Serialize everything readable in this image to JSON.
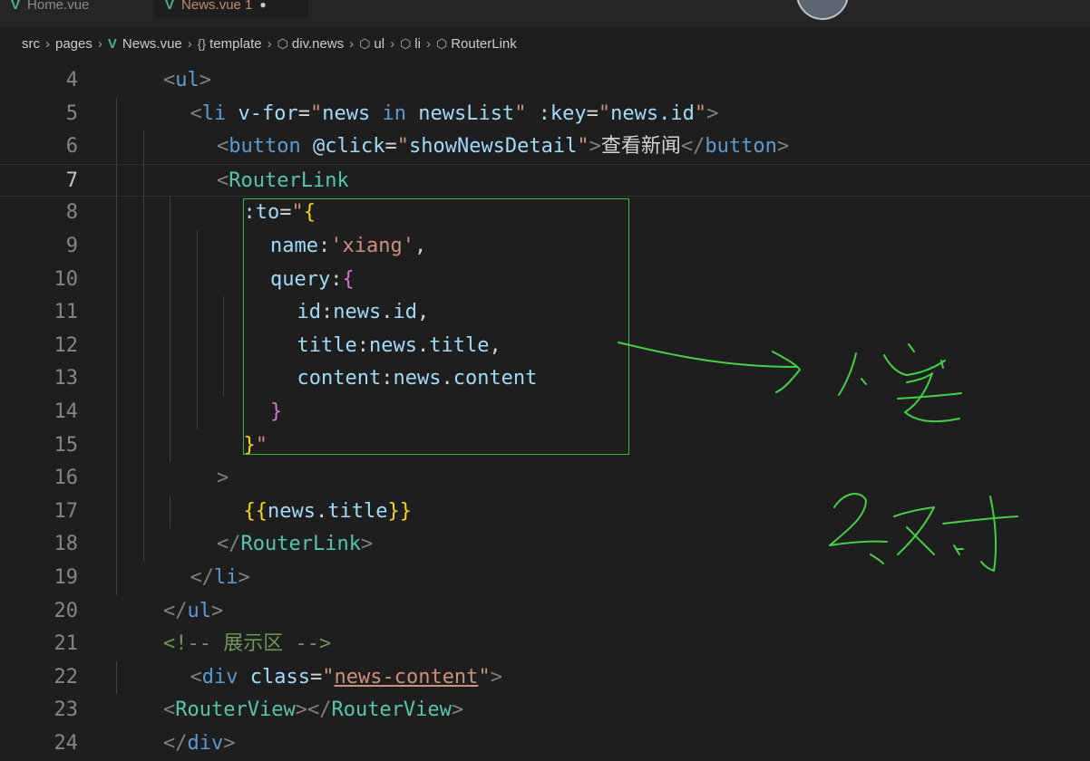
{
  "tabs": [
    {
      "label": "Home.vue",
      "active": false
    },
    {
      "label": "News.vue 1",
      "active": true
    }
  ],
  "breadcrumb": [
    "src",
    "pages",
    "News.vue",
    "template",
    "div.news",
    "ul",
    "li",
    "RouterLink"
  ],
  "code": {
    "lines": [
      {
        "n": "4",
        "parts": [
          [
            "t",
            "<"
          ],
          [
            "tag",
            "ul"
          ],
          [
            "t",
            ">"
          ]
        ]
      },
      {
        "n": "5",
        "parts": [
          [
            "t",
            "<"
          ],
          [
            "tag",
            "li"
          ],
          [
            "txt",
            " "
          ],
          [
            "attr",
            "v-for"
          ],
          [
            "txt",
            "="
          ],
          [
            "str",
            "\""
          ],
          [
            "attr",
            "news"
          ],
          [
            "txt",
            " "
          ],
          [
            "tag",
            "in"
          ],
          [
            "txt",
            " "
          ],
          [
            "attr",
            "newsList"
          ],
          [
            "str",
            "\""
          ],
          [
            "txt",
            " "
          ],
          [
            "attr",
            ":key"
          ],
          [
            "txt",
            "="
          ],
          [
            "str",
            "\""
          ],
          [
            "attr",
            "news.id"
          ],
          [
            "str",
            "\""
          ],
          [
            "t",
            ">"
          ]
        ]
      },
      {
        "n": "6",
        "parts": [
          [
            "t",
            "<"
          ],
          [
            "tag",
            "button"
          ],
          [
            "txt",
            " "
          ],
          [
            "attr",
            "@click"
          ],
          [
            "txt",
            "="
          ],
          [
            "str",
            "\""
          ],
          [
            "attr",
            "showNewsDetail"
          ],
          [
            "str",
            "\""
          ],
          [
            "t",
            ">"
          ],
          [
            "txt",
            "查看新闻"
          ],
          [
            "t",
            "</"
          ],
          [
            "tag",
            "button"
          ],
          [
            "t",
            ">"
          ]
        ]
      },
      {
        "n": "7",
        "parts": [
          [
            "t",
            "<"
          ],
          [
            "cmp",
            "RouterLink"
          ]
        ]
      },
      {
        "n": "8",
        "parts": [
          [
            "attr",
            ":to"
          ],
          [
            "txt",
            "="
          ],
          [
            "str",
            "\""
          ],
          [
            "br1",
            "{"
          ]
        ]
      },
      {
        "n": "9",
        "parts": [
          [
            "attr",
            "name"
          ],
          [
            "txt",
            ":"
          ],
          [
            "str",
            "'xiang'"
          ],
          [
            "txt",
            ","
          ]
        ]
      },
      {
        "n": "10",
        "parts": [
          [
            "attr",
            "query"
          ],
          [
            "txt",
            ":"
          ],
          [
            "br2",
            "{"
          ]
        ]
      },
      {
        "n": "11",
        "parts": [
          [
            "attr",
            "id"
          ],
          [
            "txt",
            ":"
          ],
          [
            "attr",
            "news"
          ],
          [
            "txt",
            "."
          ],
          [
            "attr",
            "id"
          ],
          [
            "txt",
            ","
          ]
        ]
      },
      {
        "n": "12",
        "parts": [
          [
            "attr",
            "title"
          ],
          [
            "txt",
            ":"
          ],
          [
            "attr",
            "news"
          ],
          [
            "txt",
            "."
          ],
          [
            "attr",
            "title"
          ],
          [
            "txt",
            ","
          ]
        ]
      },
      {
        "n": "13",
        "parts": [
          [
            "attr",
            "content"
          ],
          [
            "txt",
            ":"
          ],
          [
            "attr",
            "news"
          ],
          [
            "txt",
            "."
          ],
          [
            "attr",
            "content"
          ]
        ]
      },
      {
        "n": "14",
        "parts": [
          [
            "br2",
            "}"
          ]
        ]
      },
      {
        "n": "15",
        "parts": [
          [
            "br1",
            "}"
          ],
          [
            "str",
            "\""
          ]
        ]
      },
      {
        "n": "16",
        "parts": [
          [
            "t",
            ">"
          ]
        ]
      },
      {
        "n": "17",
        "parts": [
          [
            "br1",
            "{{"
          ],
          [
            "attr",
            "news"
          ],
          [
            "txt",
            "."
          ],
          [
            "attr",
            "title"
          ],
          [
            "br1",
            "}}"
          ]
        ]
      },
      {
        "n": "18",
        "parts": [
          [
            "t",
            "</"
          ],
          [
            "cmp",
            "RouterLink"
          ],
          [
            "t",
            ">"
          ]
        ]
      },
      {
        "n": "19",
        "parts": [
          [
            "t",
            "</"
          ],
          [
            "tag",
            "li"
          ],
          [
            "t",
            ">"
          ]
        ]
      },
      {
        "n": "20",
        "parts": [
          [
            "t",
            "</"
          ],
          [
            "tag",
            "ul"
          ],
          [
            "t",
            ">"
          ]
        ]
      },
      {
        "n": "21",
        "parts": [
          [
            "cmt",
            "<!-- 展示区 -->"
          ]
        ]
      },
      {
        "n": "22",
        "parts": [
          [
            "t",
            "<"
          ],
          [
            "tag",
            "div"
          ],
          [
            "txt",
            " "
          ],
          [
            "attr",
            "class"
          ],
          [
            "txt",
            "="
          ],
          [
            "str",
            "\""
          ],
          [
            "strU",
            "news-content"
          ],
          [
            "str",
            "\""
          ],
          [
            "t",
            ">"
          ]
        ]
      },
      {
        "n": "23",
        "parts": [
          [
            "t",
            "<"
          ],
          [
            "cmp",
            "RouterView"
          ],
          [
            "t",
            "></"
          ],
          [
            "cmp",
            "RouterView"
          ],
          [
            "t",
            ">"
          ]
        ]
      },
      {
        "n": "24",
        "parts": [
          [
            "t",
            "</"
          ],
          [
            "tag",
            "div"
          ],
          [
            "t",
            ">"
          ]
        ]
      }
    ]
  },
  "annotations": [
    "1. 字",
    "2. 对"
  ]
}
